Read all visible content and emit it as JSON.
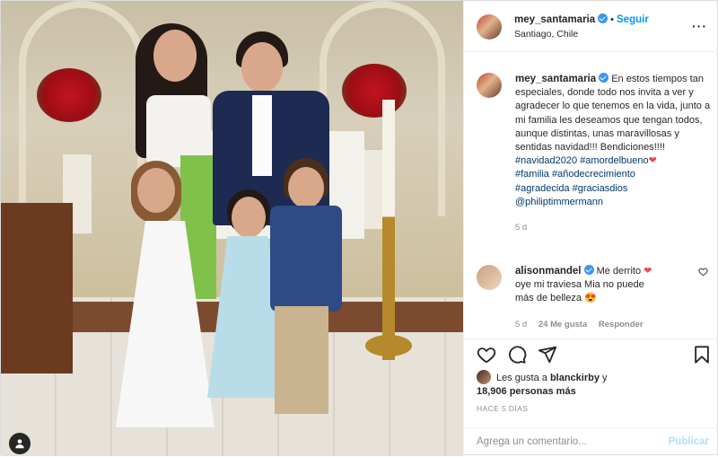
{
  "header": {
    "username": "mey_santamaria",
    "separator": "•",
    "follow_label": "Seguir",
    "location": "Santiago, Chile",
    "more_label": "···"
  },
  "caption": {
    "username": "mey_santamaria",
    "text": "En estos tiempos tan especiales, donde todo nos invita a ver y agradecer lo que tenemos en la vida, junto a mi familia les deseamos que tengan todos, aunque distintas, unas maravillosas y sentidas navidad!!! Bendiciones!!!!",
    "hashtags": [
      "#navidad2020",
      "#amordelbueno",
      "#familia",
      "#añodecrecimiento",
      "#agradecida",
      "#graciasdios"
    ],
    "mention": "@philiptimmermann",
    "age": "5 d"
  },
  "reply": {
    "username": "alisonmandel",
    "line1": "Me derrito",
    "line2": "oye mi traviesa Mia no puede",
    "line3": "más de belleza",
    "age": "5 d",
    "likes": "24 Me gusta",
    "reply_label": "Responder"
  },
  "likes": {
    "prefix": "Les gusta a",
    "user": "blanckirby",
    "connector": "y",
    "count": "18,906 personas más"
  },
  "timestamp": "HACE 5 DÍAS",
  "composer": {
    "placeholder": "Agrega un comentario...",
    "post_label": "Publicar"
  },
  "colors": {
    "accent": "#0095f6",
    "verified": "#3897f0",
    "heart": "#ed4956",
    "hashtag": "#00376b"
  },
  "icons": [
    "user-tag-icon",
    "verified-icon",
    "more-icon",
    "heart-icon",
    "comment-icon",
    "share-icon",
    "bookmark-icon"
  ]
}
